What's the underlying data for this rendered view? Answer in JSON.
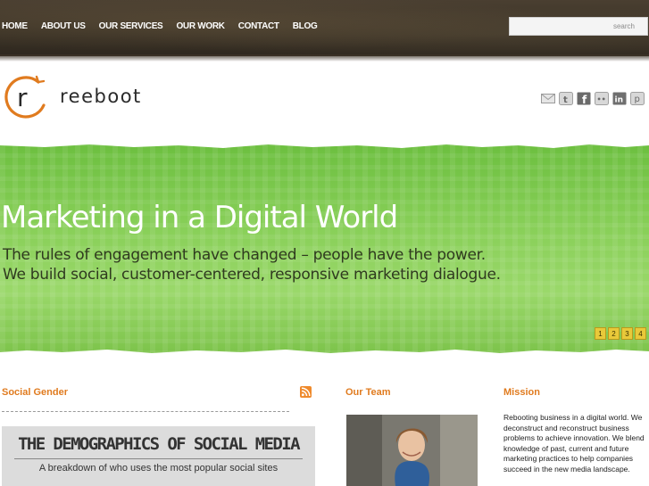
{
  "nav": {
    "items": [
      {
        "label": "HOME"
      },
      {
        "label": "ABOUT US"
      },
      {
        "label": "OUR SERVICES"
      },
      {
        "label": "OUR WORK"
      },
      {
        "label": "CONTACT"
      },
      {
        "label": "BLOG"
      }
    ]
  },
  "search": {
    "placeholder": "search"
  },
  "brand": {
    "logo_letter": "r",
    "name": "reeboot",
    "accent": "#e07b1f"
  },
  "social": {
    "icons": [
      "email-icon",
      "twitter-icon",
      "facebook-icon",
      "flickr-icon",
      "linkedin-icon",
      "pinterest-icon"
    ],
    "glyphs": {
      "twitter": "t",
      "facebook": "f",
      "flickr": "••",
      "linkedin": "in",
      "pinterest": "p"
    }
  },
  "hero": {
    "title": "Marketing in a Digital World",
    "subtitle_line1": "The rules of engagement have changed – people have the power.",
    "subtitle_line2": "We build social, customer-centered, responsive marketing dialogue.",
    "pages": [
      "1",
      "2",
      "3",
      "4"
    ],
    "pager_color": "#e8c93a"
  },
  "columns": {
    "social_gender": {
      "heading": "Social Gender",
      "feature_title": "THE DEMOGRAPHICS OF SOCIAL MEDIA",
      "feature_subtitle": "A breakdown of who uses the most popular social sites"
    },
    "our_team": {
      "heading": "Our Team"
    },
    "mission": {
      "heading": "Mission",
      "text": "Rebooting business in a digital world. We deconstruct and reconstruct business problems to achieve innovation. We blend knowledge of past, current and future marketing practices to help companies succeed in the new media landscape."
    }
  }
}
